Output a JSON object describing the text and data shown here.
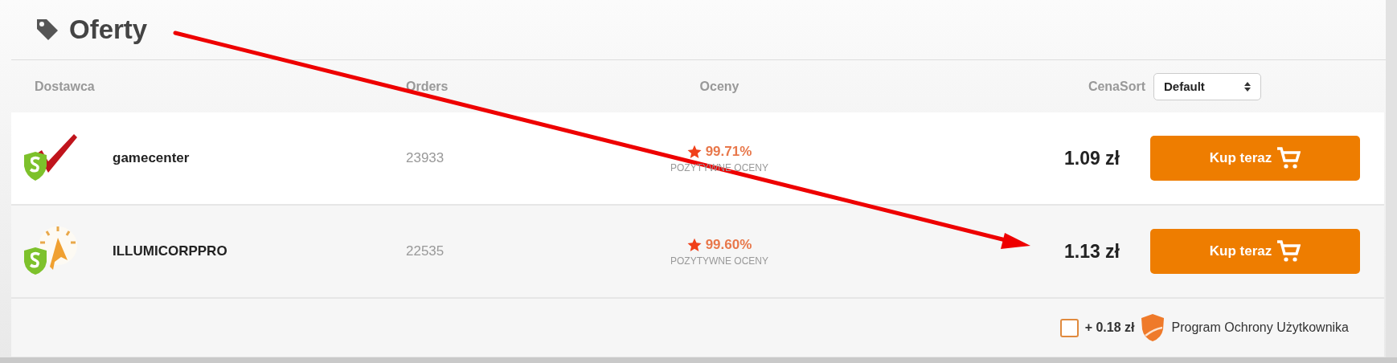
{
  "title": "Oferty",
  "columns": {
    "supplier": "Dostawca",
    "orders": "Orders",
    "ratings": "Oceny",
    "price": "Cena",
    "sort_label": "Sort",
    "sort_value": "Default"
  },
  "offers": [
    {
      "kind": "check",
      "name": "gamecenter",
      "orders": "23933",
      "rating": "99.71%",
      "rating_label": "POZYTYWNE OCENY",
      "price": "1.09 zł",
      "button": "Kup teraz"
    },
    {
      "kind": "sun",
      "name": "ILLUMICORPPRO",
      "orders": "22535",
      "rating": "99.60%",
      "rating_label": "POZYTYWNE OCENY",
      "price": "1.13 zł",
      "button": "Kup teraz"
    }
  ],
  "protection": {
    "checked": false,
    "price": "+ 0.18 zł",
    "label": "Program Ochrony Użytkownika"
  }
}
